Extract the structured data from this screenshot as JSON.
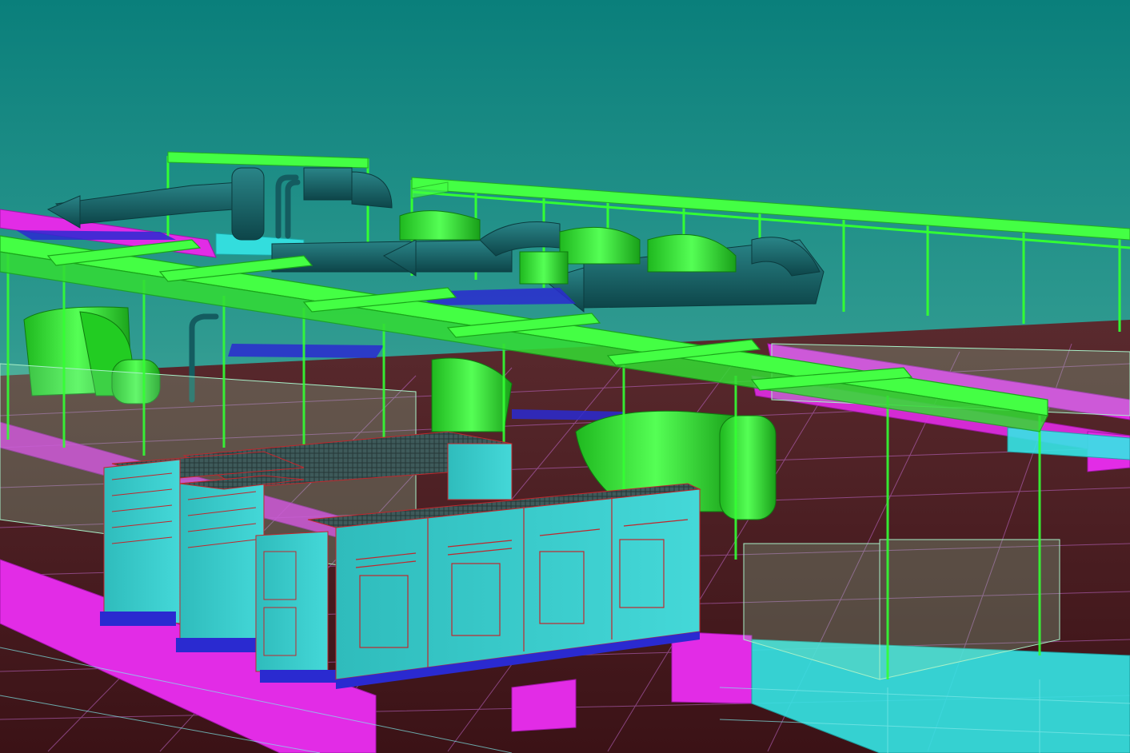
{
  "scene": {
    "colors": {
      "sky_top": "#0a7f7b",
      "sky_bottom": "#5fb3a6",
      "floor": "#4a1a1e",
      "frame_green": "#33ff33",
      "duct_teal": "#1d6b6e",
      "duct_dark": "#0f4d52",
      "pipe_magenta": "#e22ce6",
      "pipe_cyan": "#35e6e6",
      "glass": "#8fe0b0",
      "unit_cyan": "#33cccc",
      "unit_line": "#c0272d",
      "base_blue": "#2a2ad0"
    }
  }
}
